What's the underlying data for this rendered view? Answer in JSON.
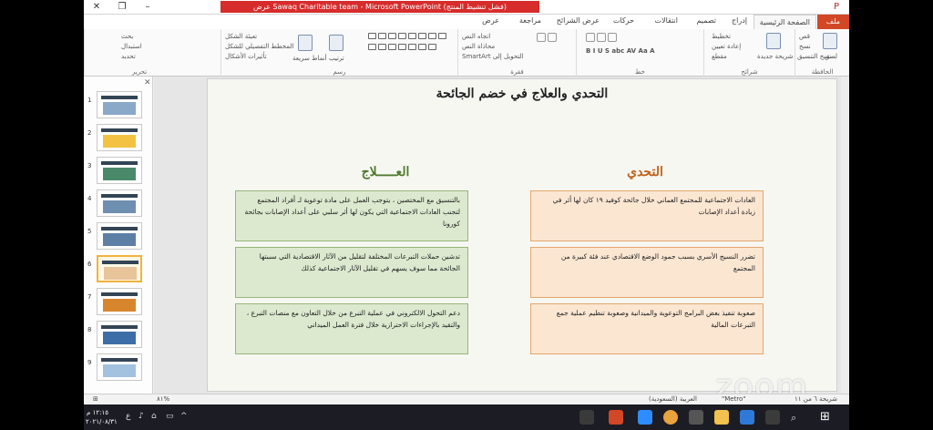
{
  "window": {
    "title": "عرض Sawaq Charitable team - Microsoft PowerPoint (فشل تنشيط المنتج)",
    "minimize": "–",
    "restore": "❐",
    "close": "✕"
  },
  "tabs": [
    "ملف",
    "الصفحة الرئيسية",
    "إدراج",
    "تصميم",
    "انتقالات",
    "حركات",
    "عرض الشرائح",
    "مراجعة",
    "عرض"
  ],
  "ribbon": {
    "clipboard": {
      "label": "الحافظة",
      "paste": "لصق",
      "cut": "قص",
      "copy": "نسخ",
      "format": "نسخ التنسيق"
    },
    "slides": {
      "label": "شرائح",
      "new": "شريحة جديدة",
      "layout": "تخطيط",
      "reset": "إعادة تعيين",
      "section": "مقطع"
    },
    "font": {
      "label": "خط"
    },
    "paragraph": {
      "label": "فقرة",
      "dir": "اتجاه النص",
      "align": "محاذاة النص",
      "smartart": "التحويل إلى SmartArt"
    },
    "drawing": {
      "label": "رسم",
      "arrange": "ترتيب",
      "quick": "أنماط سريعة",
      "fill": "تعبئة الشكل",
      "outline": "المخطط التفصيلي للشكل",
      "effects": "تأثيرات الأشكال"
    },
    "editing": {
      "label": "تحرير",
      "find": "بحث",
      "replace": "استبدال",
      "select": "تحديد"
    }
  },
  "slides_pane": {
    "numbers": [
      "1",
      "2",
      "3",
      "4",
      "5",
      "6",
      "7",
      "8",
      "9"
    ],
    "selected": "6"
  },
  "slide": {
    "title": "التحدي والعلاج في خضم الجائحة",
    "treatment_heading": "العـــــلاج",
    "challenge_heading": "التحدي",
    "treatments": [
      "بالتنسيق مع المختصين ، يتوجب العمل على مادة توعوية لـ أفراد المجتمع لتجنب العادات الاجتماعية التي يكون لها أثر سلبي على أعداد الإصابات بجائحة كورونا",
      "تدشين حملات التبرعات المختلفة لتقليل من الآثار الاقتصادية التي سببتها الجائحة مما سوف يسهم في تقليل الآثار الاجتماعية كذلك",
      "دعم التحول الالكتروني في عملية التبرع من خلال التعاون مع منصات التبرع ، والتقيد بالإجراءات الاحترازية خلال فترة العمل الميداني"
    ],
    "challenges": [
      "العادات الاجتماعية للمجتمع العماني خلال جائحة كوفيد ١٩ كان لها أثر في زيادة أعداد الإصابات",
      "تضرر النسيج الأسري بسبب جمود الوضع الاقتصادي عند فئة كبيرة من المجتمع",
      "صعوبة تنفيذ بعض البرامج التوعوية والميدانية وصعوبة تنظيم عملية جمع التبرعات المالية"
    ]
  },
  "statusbar": {
    "slide_info": "شريحة ٦ من ١١",
    "theme": "\"Metro\"",
    "language": "العربية (السعودية)",
    "zoom": "٨١%"
  },
  "watermark": "zoom",
  "taskbar": {
    "time": "١٢:١٥ م",
    "date": "٢٠٢١/٠٨/٣١",
    "lang": "ع"
  },
  "colors": {
    "title_bar_accent": "#d72c2c",
    "file_tab": "#d24726",
    "treatment_heading": "#4e7a2e",
    "challenge_heading": "#c0621c",
    "treatment_fill": "#dce9cf",
    "challenge_fill": "#fbe6d2"
  }
}
